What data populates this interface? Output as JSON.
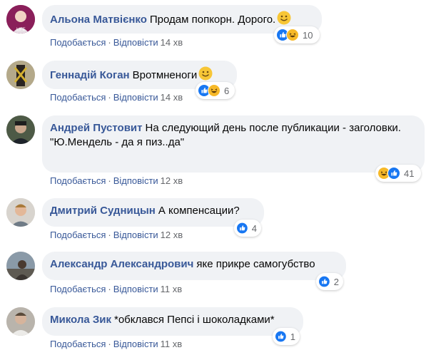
{
  "actions": {
    "like": "Подобається",
    "reply": "Відповісти",
    "dot": "·"
  },
  "comments": [
    {
      "author": "Альона Матвієнко",
      "text": "Продам попкорн. Дорого.",
      "emoji": "smile",
      "reactions": [
        "like",
        "haha"
      ],
      "count": "10",
      "time": "14 хв"
    },
    {
      "author": "Геннадій Коган",
      "text": "Вротмненоги",
      "emoji": "smile",
      "reactions": [
        "like",
        "haha"
      ],
      "count": "6",
      "time": "14 хв"
    },
    {
      "author": "Андрей Пустовит",
      "text": "На следующий день после публикации - заголовки.\n\"Ю.Мендель - да я пиз..да\"",
      "emoji": "",
      "reactions": [
        "haha",
        "like"
      ],
      "count": "41",
      "time": "12 хв"
    },
    {
      "author": "Дмитрий Судницын",
      "text": "А компенсации?",
      "emoji": "",
      "reactions": [
        "like"
      ],
      "count": "4",
      "time": "12 хв"
    },
    {
      "author": "Александр Александрович",
      "text": "яке прикре самогубство",
      "emoji": "",
      "reactions": [
        "like"
      ],
      "count": "2",
      "time": "11 хв"
    },
    {
      "author": "Микола Зик",
      "text": "*обклався Пепсі і шоколадками*",
      "emoji": "",
      "reactions": [
        "like"
      ],
      "count": "1",
      "time": "11 хв"
    }
  ],
  "colors": {
    "link": "#385898",
    "bubble": "#f0f2f5",
    "like": "#1877f2",
    "haha": "#f7b928"
  },
  "icons": {
    "like": "like-reaction-icon",
    "haha": "haha-reaction-icon",
    "smile": "smile-emoji-icon"
  }
}
